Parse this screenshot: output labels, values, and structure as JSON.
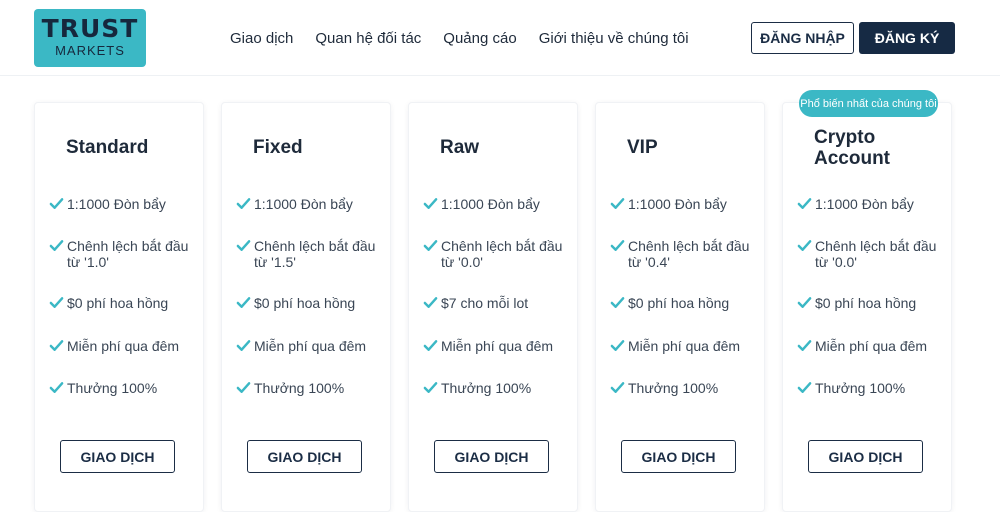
{
  "header": {
    "logo_top": "TRUST",
    "logo_bottom": "MARKETS",
    "nav": [
      "Giao dịch",
      "Quan hệ đối tác",
      "Quảng cáo",
      "Giới thiệu về chúng tôi"
    ],
    "login_label": "ĐĂNG NHẬP",
    "register_label": "ĐĂNG KÝ"
  },
  "colors": {
    "accent": "#3bb8c5",
    "navy": "#162a44",
    "check": "#3bb8c5"
  },
  "badge": "Phổ biến nhất của chúng tôi",
  "cards": [
    {
      "title": "Standard",
      "features": [
        "1:1000 Đòn bẩy",
        "Chênh lệch bắt đầu từ '1.0'",
        "$0 phí hoa hồng",
        "Miễn phí qua đêm",
        "Thưởng 100%"
      ],
      "button": "GIAO DỊCH"
    },
    {
      "title": "Fixed",
      "features": [
        "1:1000 Đòn bẩy",
        "Chênh lệch bắt đầu từ '1.5'",
        "$0 phí hoa hồng",
        "Miễn phí qua đêm",
        "Thưởng 100%"
      ],
      "button": "GIAO DỊCH"
    },
    {
      "title": "Raw",
      "features": [
        "1:1000 Đòn bẩy",
        "Chênh lệch bắt đầu từ '0.0'",
        "$7 cho mỗi lot",
        "Miễn phí qua đêm",
        "Thưởng 100%"
      ],
      "button": "GIAO DỊCH"
    },
    {
      "title": "VIP",
      "features": [
        "1:1000 Đòn bẩy",
        "Chênh lệch bắt đầu từ '0.4'",
        "$0 phí hoa hồng",
        "Miễn phí qua đêm",
        "Thưởng 100%"
      ],
      "button": "GIAO DỊCH"
    },
    {
      "title": "Crypto Account",
      "features": [
        "1:1000 Đòn bẩy",
        "Chênh lệch bắt đầu từ '0.0'",
        "$0 phí hoa hồng",
        "Miễn phí qua đêm",
        "Thưởng 100%"
      ],
      "button": "GIAO DỊCH"
    }
  ]
}
